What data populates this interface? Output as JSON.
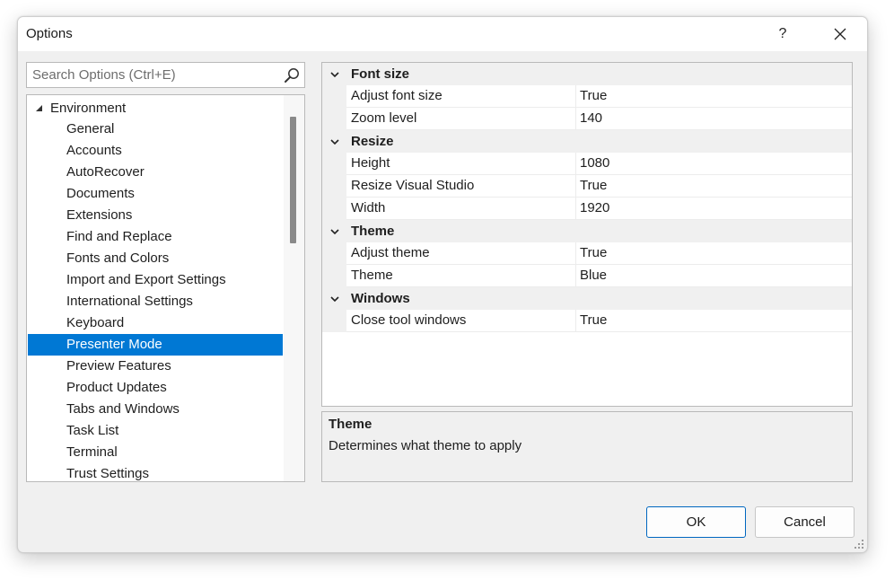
{
  "window": {
    "title": "Options",
    "help_label": "?",
    "close_icon": "close-icon"
  },
  "search": {
    "placeholder": "Search Options (Ctrl+E)",
    "value": "",
    "icon": "search-icon"
  },
  "tree": {
    "root": {
      "label": "Environment",
      "expanded": true
    },
    "items": [
      {
        "label": "General",
        "selected": false
      },
      {
        "label": "Accounts",
        "selected": false
      },
      {
        "label": "AutoRecover",
        "selected": false
      },
      {
        "label": "Documents",
        "selected": false
      },
      {
        "label": "Extensions",
        "selected": false
      },
      {
        "label": "Find and Replace",
        "selected": false
      },
      {
        "label": "Fonts and Colors",
        "selected": false
      },
      {
        "label": "Import and Export Settings",
        "selected": false
      },
      {
        "label": "International Settings",
        "selected": false
      },
      {
        "label": "Keyboard",
        "selected": false
      },
      {
        "label": "Presenter Mode",
        "selected": true
      },
      {
        "label": "Preview Features",
        "selected": false
      },
      {
        "label": "Product Updates",
        "selected": false
      },
      {
        "label": "Tabs and Windows",
        "selected": false
      },
      {
        "label": "Task List",
        "selected": false
      },
      {
        "label": "Terminal",
        "selected": false
      },
      {
        "label": "Trust Settings",
        "selected": false
      }
    ]
  },
  "grid": {
    "categories": [
      {
        "label": "Font size",
        "properties": [
          {
            "name": "Adjust font size",
            "value": "True"
          },
          {
            "name": "Zoom level",
            "value": "140"
          }
        ]
      },
      {
        "label": "Resize",
        "properties": [
          {
            "name": "Height",
            "value": "1080"
          },
          {
            "name": "Resize Visual Studio",
            "value": "True"
          },
          {
            "name": "Width",
            "value": "1920"
          }
        ]
      },
      {
        "label": "Theme",
        "properties": [
          {
            "name": "Adjust theme",
            "value": "True"
          },
          {
            "name": "Theme",
            "value": "Blue"
          }
        ]
      },
      {
        "label": "Windows",
        "properties": [
          {
            "name": "Close tool windows",
            "value": "True"
          }
        ]
      }
    ]
  },
  "description": {
    "title": "Theme",
    "text": "Determines what theme to apply"
  },
  "buttons": {
    "ok": "OK",
    "cancel": "Cancel"
  },
  "colors": {
    "selection": "#0078d4",
    "ok_border": "#0067c0"
  }
}
